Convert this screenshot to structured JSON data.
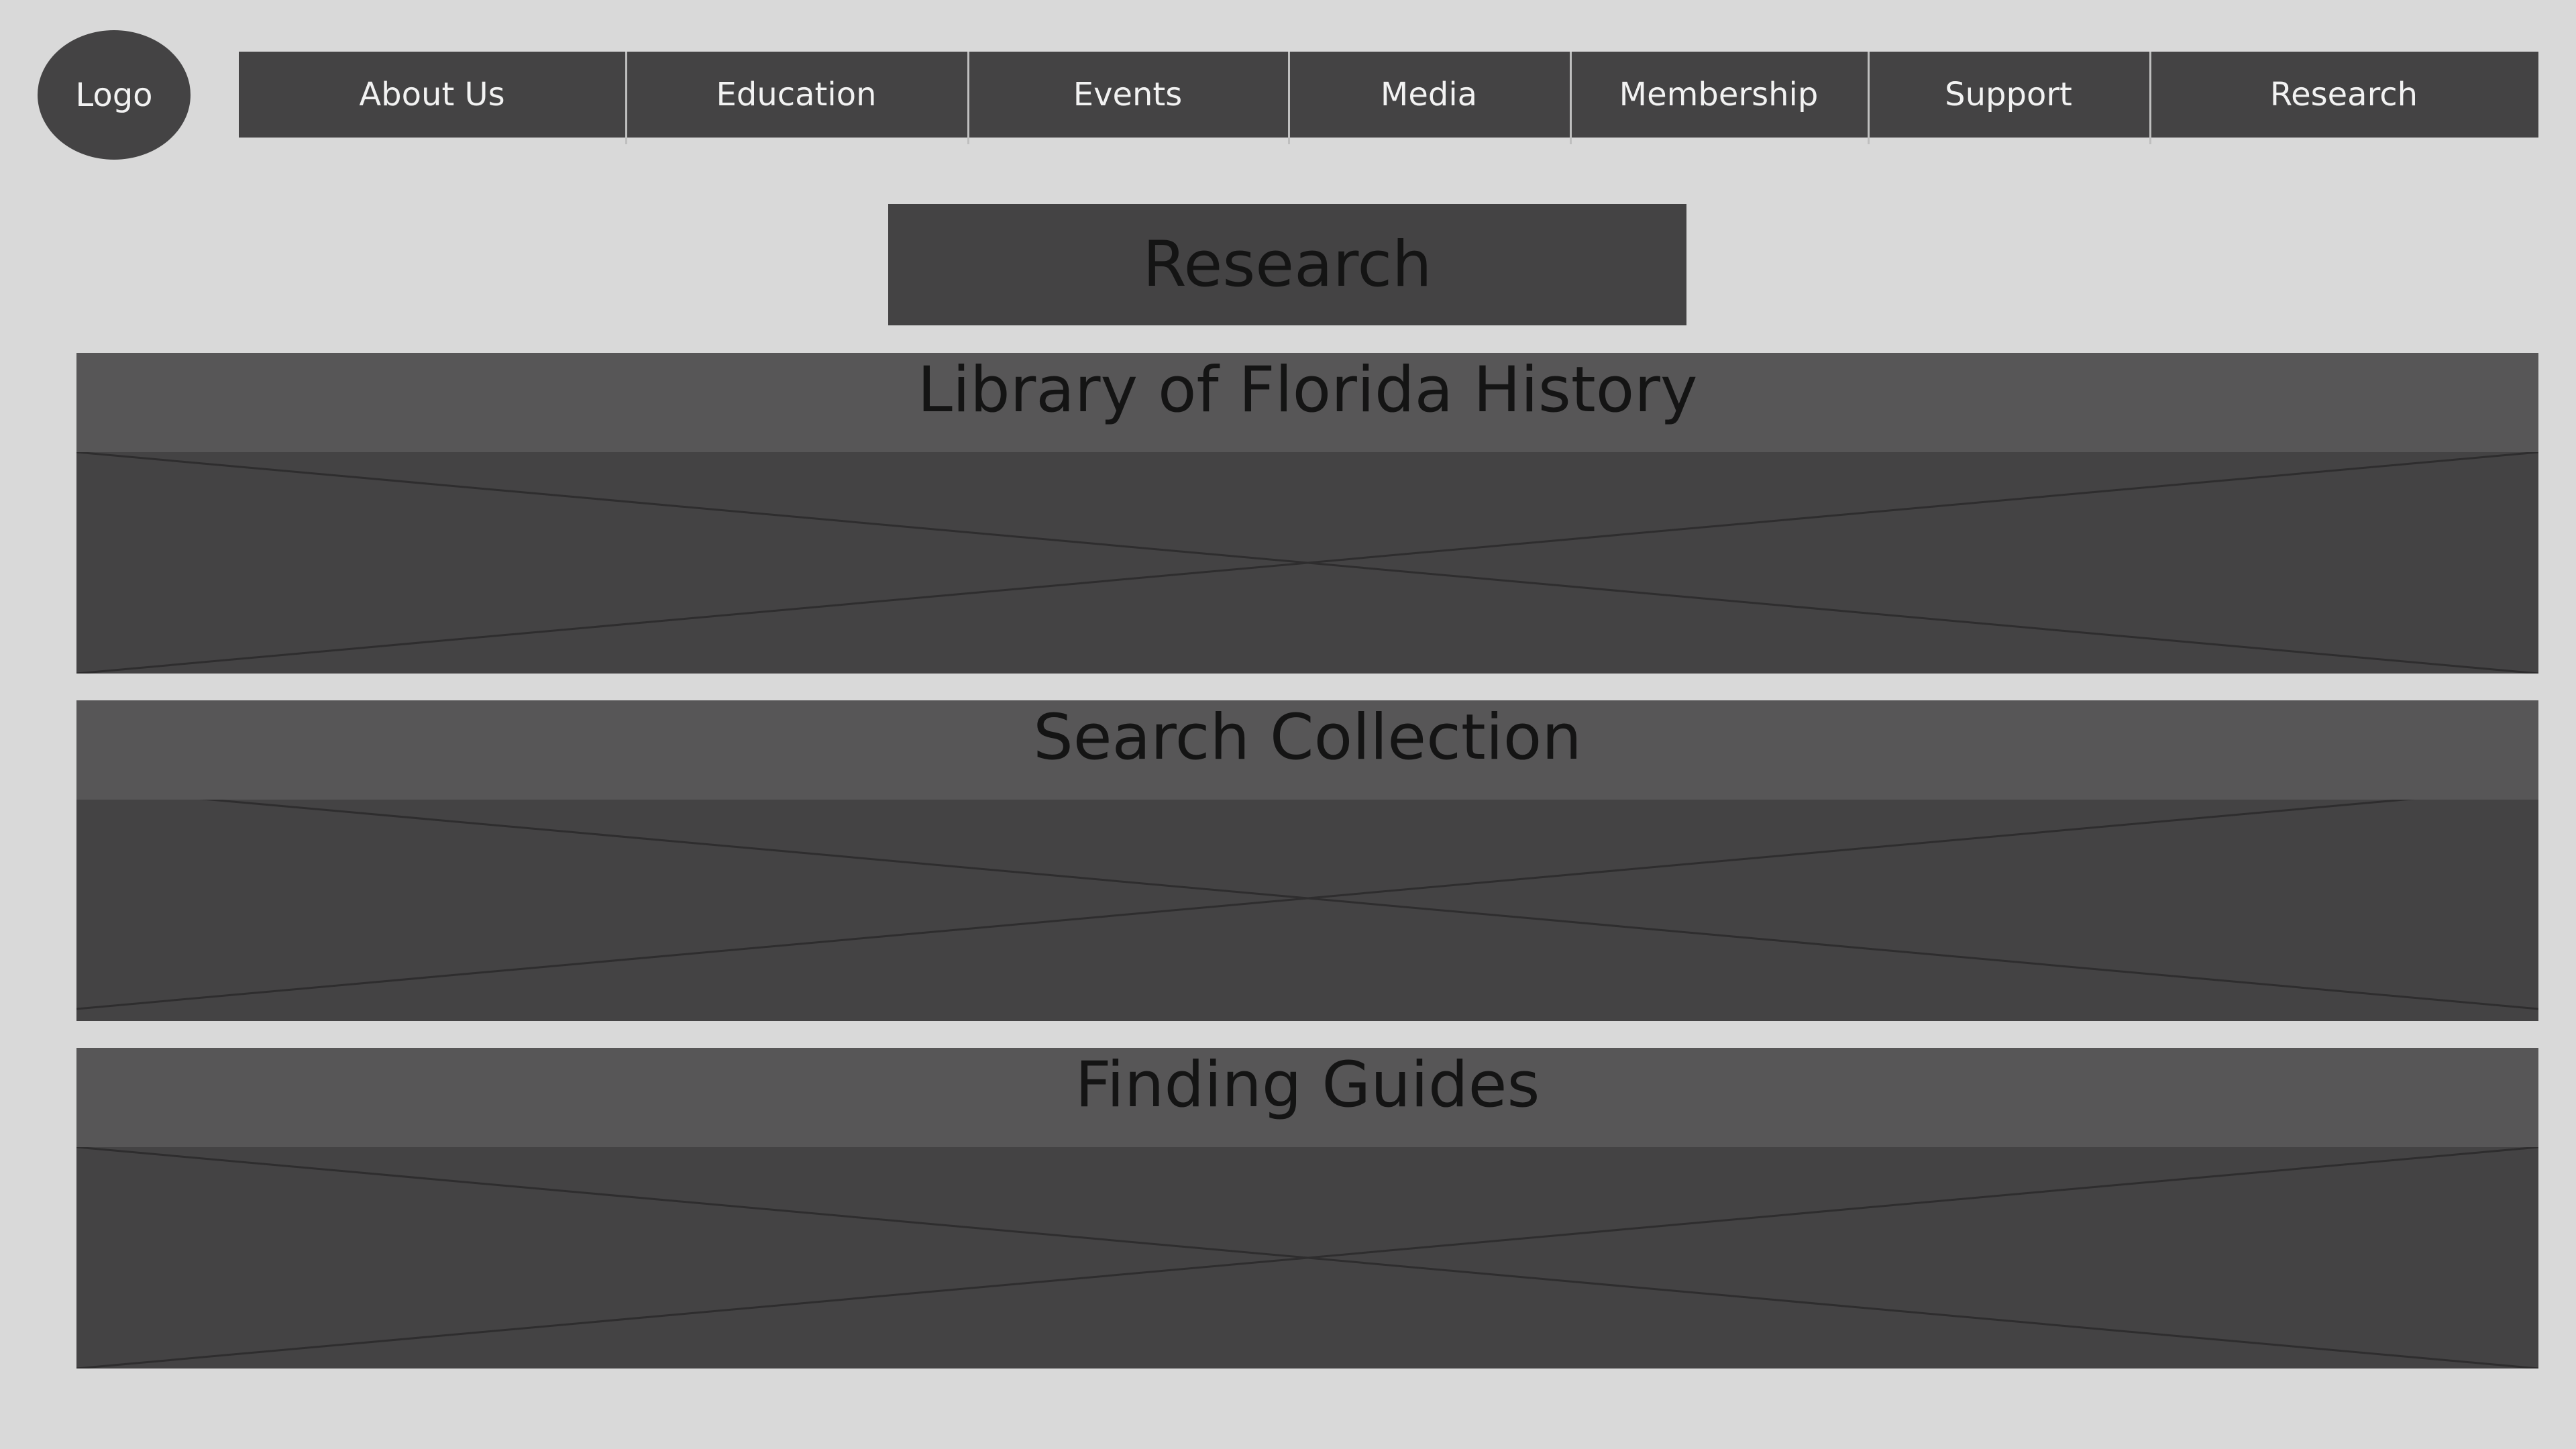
{
  "logo": {
    "label": "Logo"
  },
  "nav": {
    "items": [
      {
        "label": "About Us"
      },
      {
        "label": "Education"
      },
      {
        "label": "Events"
      },
      {
        "label": "Media"
      },
      {
        "label": "Membership"
      },
      {
        "label": "Support"
      },
      {
        "label": "Research"
      }
    ]
  },
  "page": {
    "title": "Research"
  },
  "sections": [
    {
      "title": "Library of Florida History"
    },
    {
      "title": "Search Collection"
    },
    {
      "title": "Finding Guides"
    }
  ],
  "colors": {
    "background": "#d9d9d9",
    "nav_bg": "#444344",
    "section_header_bg": "#575657",
    "placeholder_bg": "#444344",
    "nav_text": "#f2f2f2",
    "heading_text": "#141414"
  }
}
